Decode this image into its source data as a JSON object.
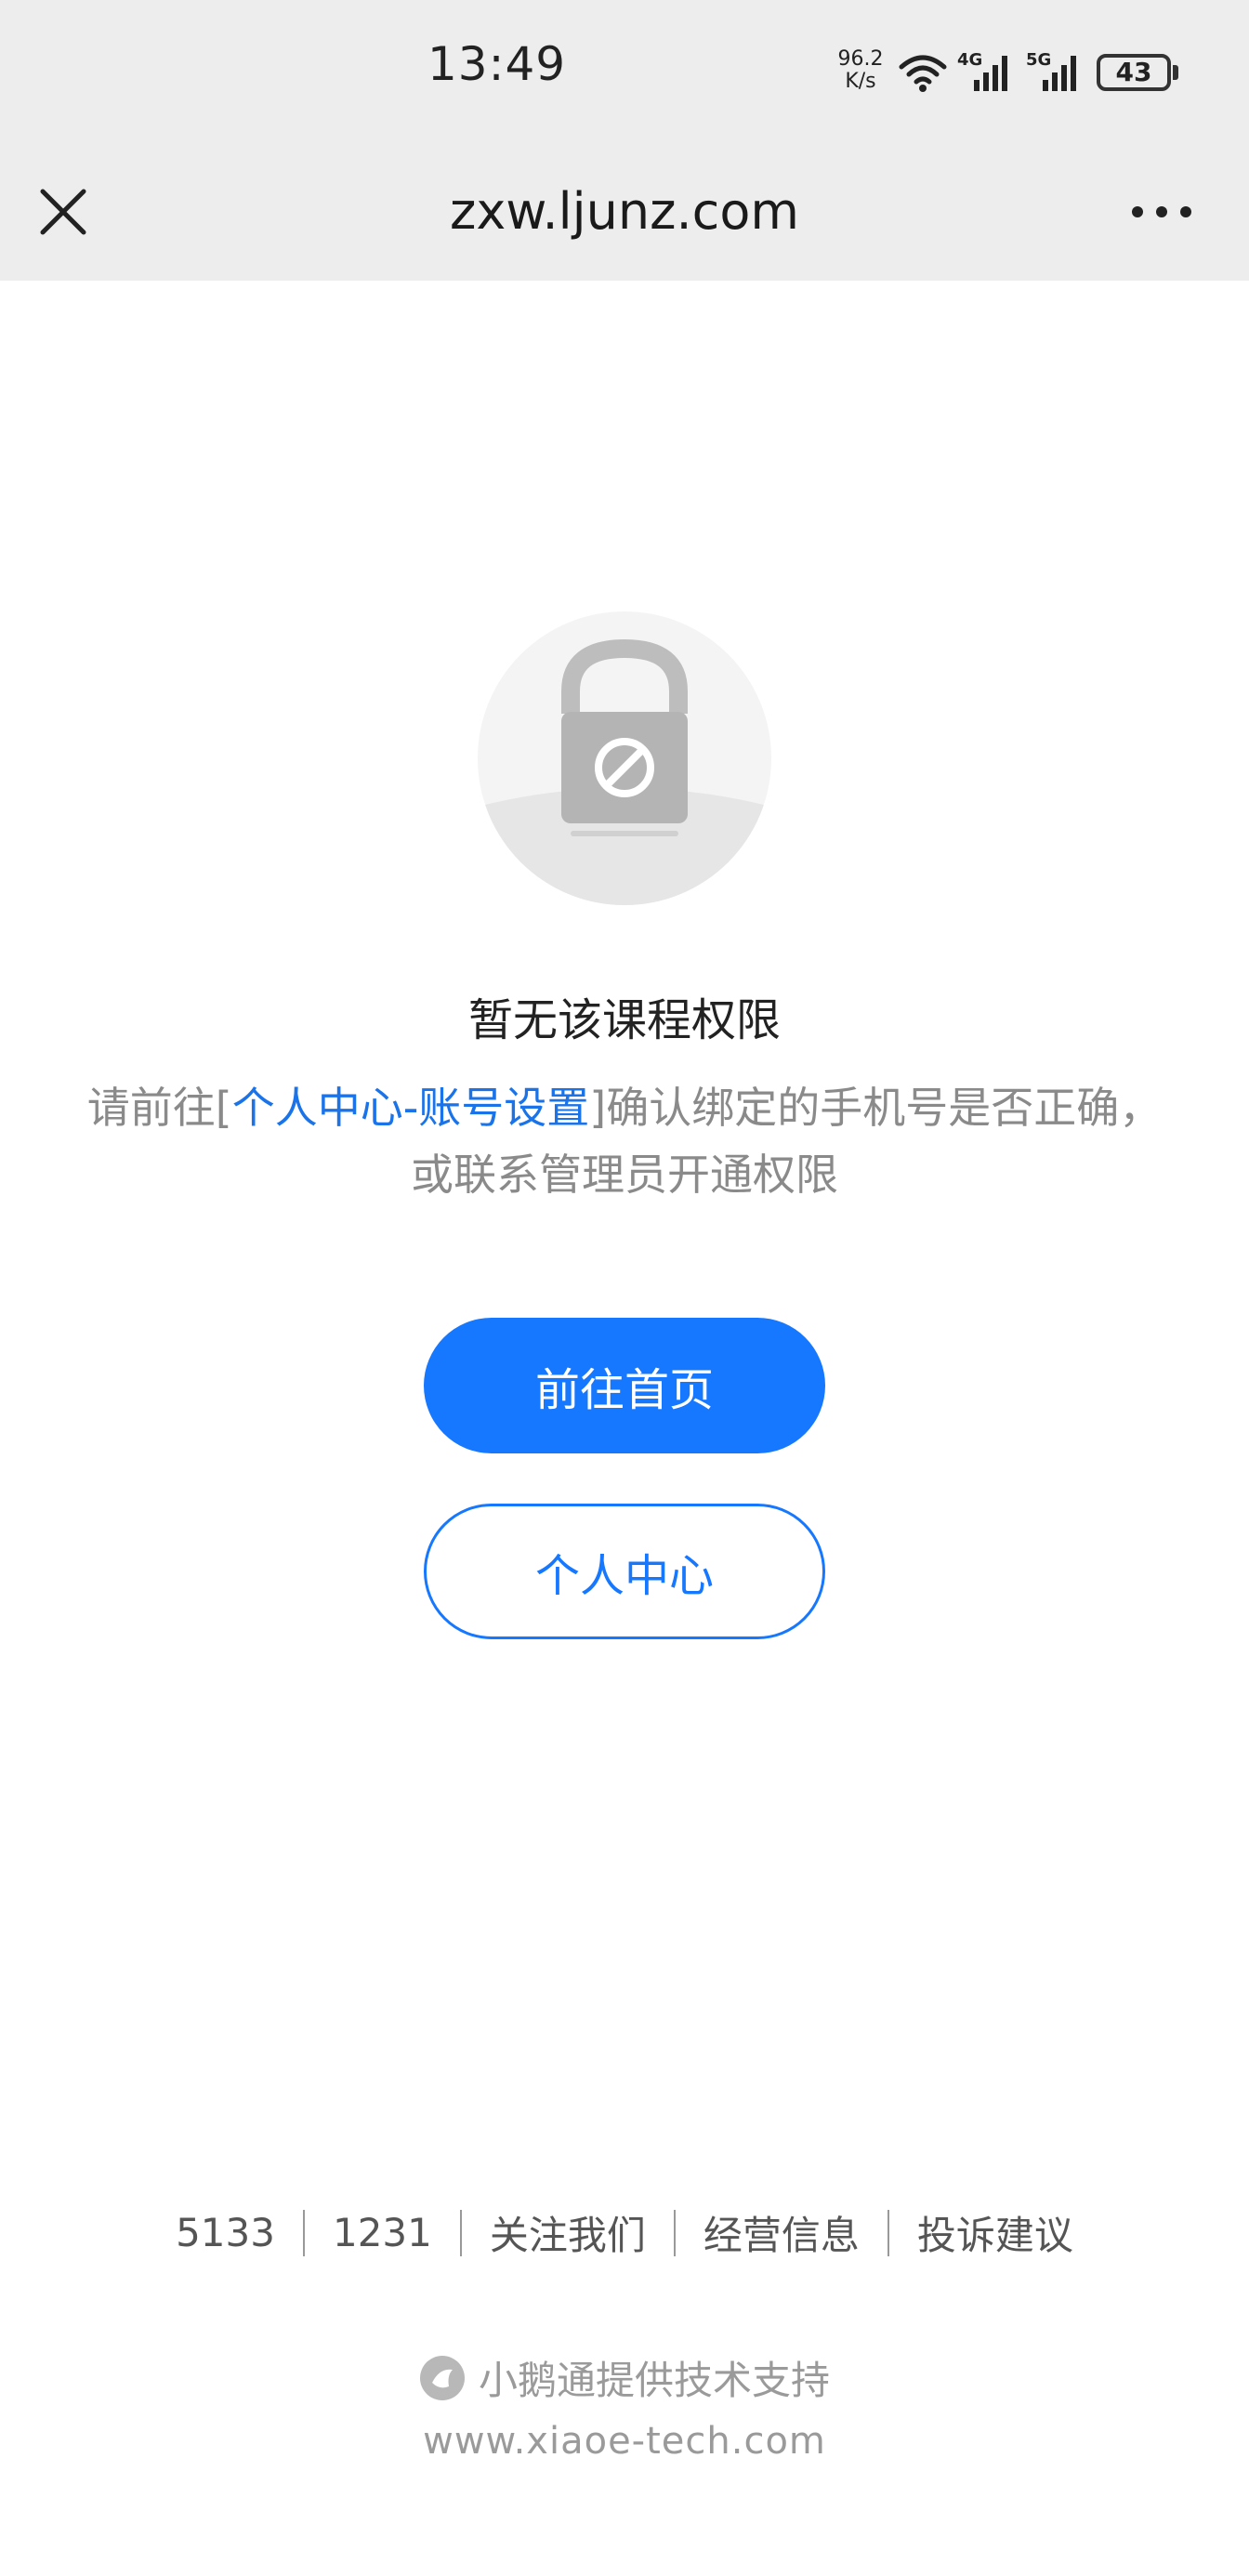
{
  "status_bar": {
    "time": "13:49",
    "net_speed_value": "96.2",
    "net_speed_unit": "K/s",
    "signal_4g": "4G",
    "signal_5g": "5G",
    "battery": "43"
  },
  "nav": {
    "title": "zxw.ljunz.com",
    "close_icon": "close-icon",
    "more_icon": "more-dots-icon"
  },
  "main": {
    "illustration": "lock-forbidden-icon",
    "title": "暂无该课程权限",
    "desc_prefix": "请前往[",
    "desc_link": "个人中心-账号设置",
    "desc_suffix": "]确认绑定的手机号是否正确，或联系管理员开通权限",
    "primary_button": "前往首页",
    "secondary_button": "个人中心"
  },
  "footer": {
    "links": [
      "5133",
      "1231",
      "关注我们",
      "经营信息",
      "投诉建议"
    ],
    "brand_text": "小鹅通提供技术支持",
    "brand_url": "www.xiaoe-tech.com"
  },
  "colors": {
    "accent": "#1677ff",
    "link": "#1a73e8",
    "bar_bg": "#ededed",
    "muted_text": "#8a8a8a"
  }
}
